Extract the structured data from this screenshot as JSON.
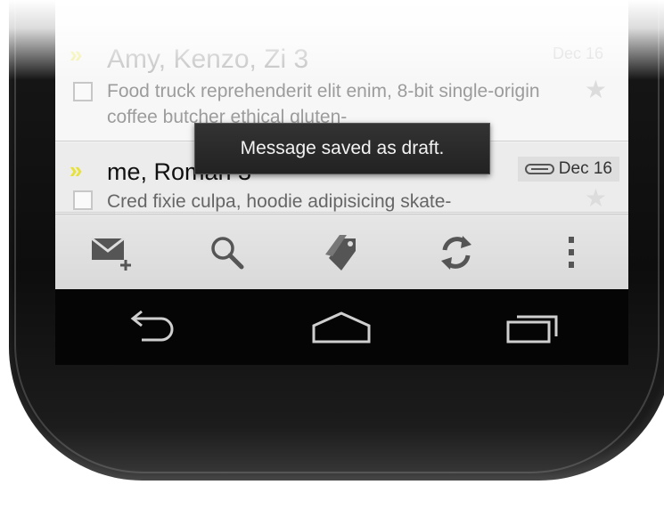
{
  "inbox": {
    "rows": [
      {
        "sender": "Amy, Kenzo, Zi  3",
        "date": "Dec 16",
        "snippet": "Food truck reprehenderit elit enim, 8-bit single-origin coffee butcher ethical gluten-"
      },
      {
        "sender": "me, Roman  3",
        "date": "Dec 16",
        "snippet": "Cred fixie culpa, hoodie adipisicing skate-"
      }
    ]
  },
  "toast": {
    "message": "Message saved as draft."
  },
  "action_bar": {
    "icons": [
      "compose-icon",
      "search-icon",
      "labels-icon",
      "refresh-icon",
      "overflow-menu-icon"
    ]
  },
  "nav_bar": {
    "icons": [
      "back-icon",
      "home-icon",
      "recent-apps-icon"
    ]
  }
}
